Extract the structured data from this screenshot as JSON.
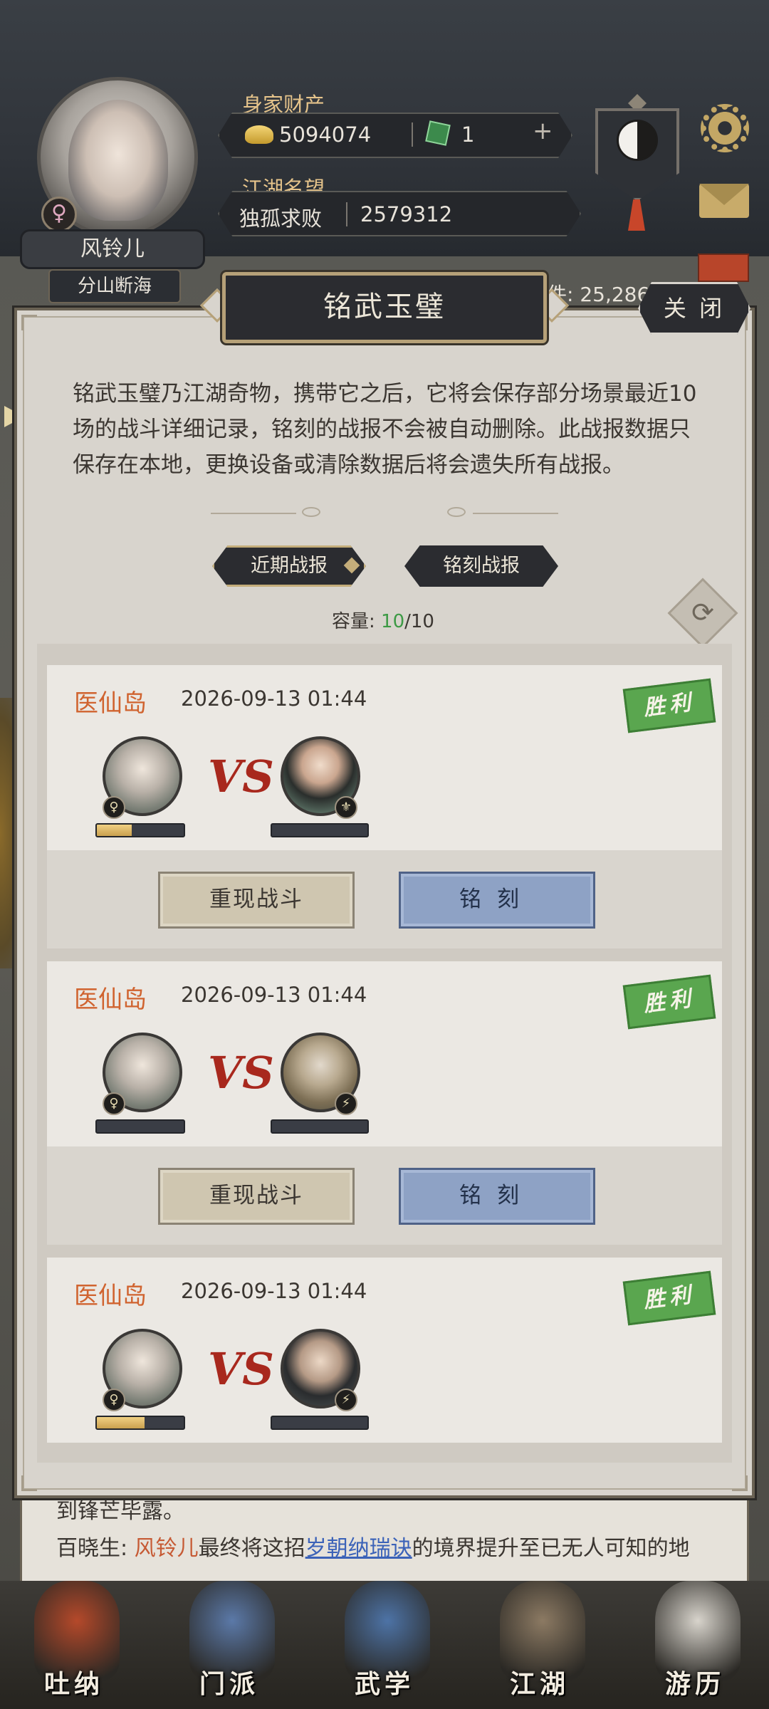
{
  "player": {
    "name": "风铃儿",
    "title": "分山断海",
    "gender_symbol": "♀"
  },
  "hud": {
    "wealth_label": "身家财产",
    "gold": "5094074",
    "jade": "1",
    "fame_label": "江湖名望",
    "fame_rank": "独孤求败",
    "fame_value": "2579312"
  },
  "background": {
    "count_text": "件: 25,286",
    "story_line1": "到锋芒毕露。",
    "story_prefix": "百晓生: ",
    "story_name": "风铃儿",
    "story_mid": "最终将这招",
    "story_skill": "岁朝纳瑞诀",
    "story_suffix": "的境界提升至已无人可知的地"
  },
  "modal": {
    "title": "铭武玉璧",
    "close_label": "关 闭",
    "description": "铭武玉璧乃江湖奇物，携带它之后，它将会保存部分场景最近10场的战斗详细记录，铭刻的战报不会被自动删除。此战报数据只保存在本地，更换设备或清除数据后将会遗失所有战报。",
    "tabs": [
      "近期战报",
      "铭刻战报"
    ],
    "capacity_label": "容量: ",
    "capacity_used": "10",
    "capacity_total": "/10",
    "vs_text": "VS"
  },
  "battles": [
    {
      "location": "医仙岛",
      "time": "2026-09-13 01:44",
      "result": "胜利",
      "hero_hp": 0.4,
      "opp_badge": "⚜",
      "replay_label": "重现战斗",
      "carve_label": "铭刻"
    },
    {
      "location": "医仙岛",
      "time": "2026-09-13 01:44",
      "result": "胜利",
      "hero_hp": 0.0,
      "opp_badge": "⚡",
      "replay_label": "重现战斗",
      "carve_label": "铭刻"
    },
    {
      "location": "医仙岛",
      "time": "2026-09-13 01:44",
      "result": "胜利",
      "hero_hp": 0.55,
      "opp_badge": "⚡"
    }
  ],
  "nav": [
    {
      "label": "吐纳",
      "color": "#b5492a"
    },
    {
      "label": "门派",
      "color": "#5b79a8"
    },
    {
      "label": "武学",
      "color": "#4d73a6"
    },
    {
      "label": "江湖",
      "color": "#8c7a63"
    },
    {
      "label": "游历",
      "color": "#d8d4cc"
    }
  ]
}
